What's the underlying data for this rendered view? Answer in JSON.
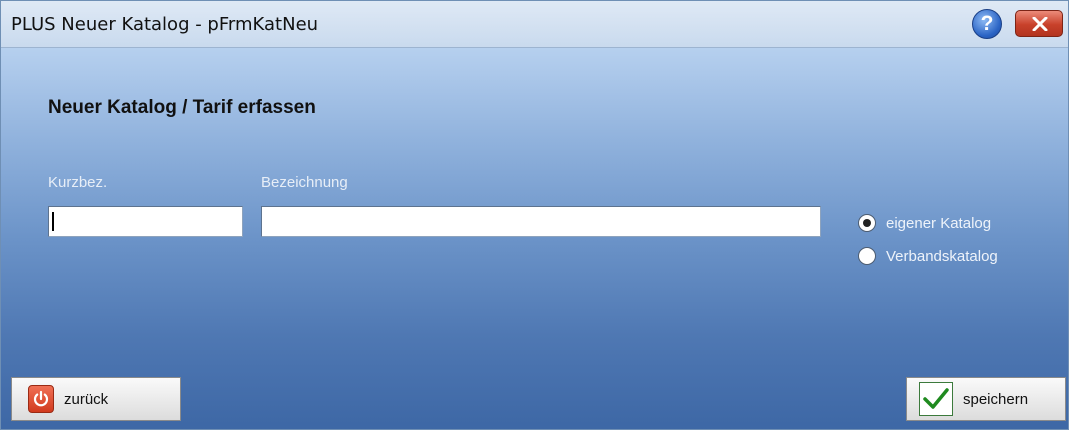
{
  "window": {
    "title": "PLUS Neuer Katalog - pFrmKatNeu",
    "help_glyph": "?"
  },
  "form": {
    "heading": "Neuer Katalog / Tarif erfassen",
    "kurzbez_label": "Kurzbez.",
    "kurzbez_value": "",
    "bezeichnung_label": "Bezeichnung",
    "bezeichnung_value": ""
  },
  "catalog_type": {
    "selected": "eigener Katalog",
    "options": [
      "eigener Katalog",
      "Verbandskatalog"
    ]
  },
  "buttons": {
    "back_label": "zurück",
    "back_icon": "power-icon",
    "save_label": "speichern",
    "save_icon": "check-icon"
  },
  "colors": {
    "close_button": "#c8412b",
    "help_button": "#2a63c4",
    "background_gradient_top": "#b6d0ef",
    "background_gradient_bottom": "#3d67a5",
    "check_green": "#1f8a1f"
  }
}
